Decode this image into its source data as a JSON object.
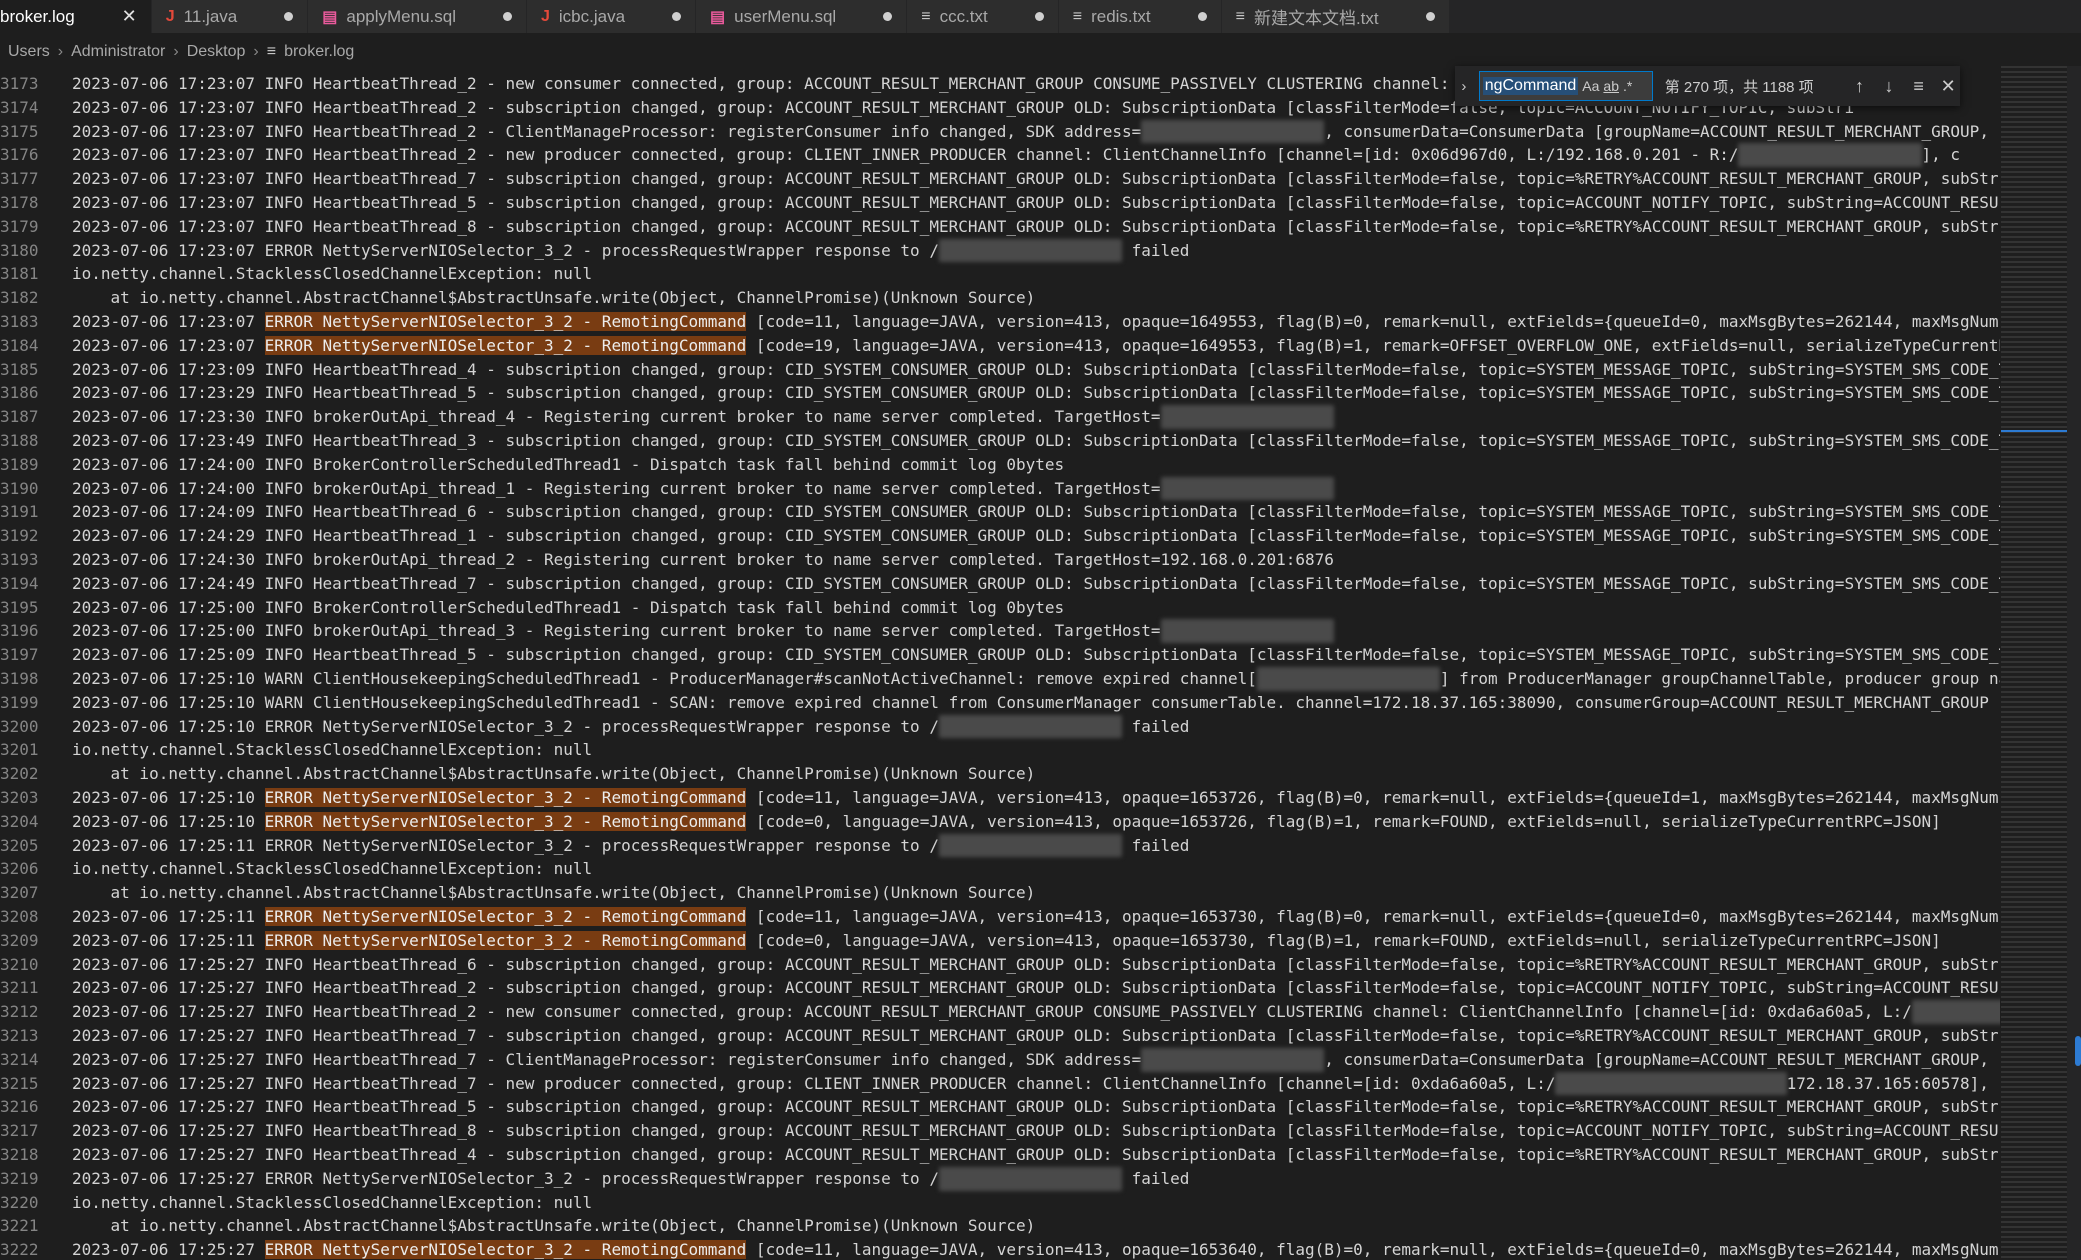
{
  "tabs": [
    {
      "label": "broker.log",
      "active": true,
      "icon": "log-file-icon"
    },
    {
      "label": "11.java",
      "icon": "java-icon"
    },
    {
      "label": "applyMenu.sql",
      "icon": "database-icon"
    },
    {
      "label": "icbc.java",
      "icon": "java-icon"
    },
    {
      "label": "userMenu.sql",
      "icon": "database-icon"
    },
    {
      "label": "ccc.txt",
      "icon": "text-file-icon"
    },
    {
      "label": "redis.txt",
      "icon": "text-file-icon"
    },
    {
      "label": "新建文本文档.txt",
      "icon": "text-file-icon"
    }
  ],
  "breadcrumb": [
    "Users",
    "Administrator",
    "Desktop",
    "broker.log"
  ],
  "find": {
    "term": "ngCommand",
    "opt_case": "Aa",
    "opt_word": "ab",
    "opt_regex": ".*",
    "count": "第 270 项，共 1188 项"
  },
  "colors": {
    "match_highlight": "#793c12",
    "find_border": "#007acc"
  },
  "lines": [
    {
      "n": "3173",
      "segs": [
        {
          "t": "2023-07-06 17:23:07 INFO HeartbeatThread_2 - new consumer connected, group: ACCOUNT_RESULT_MERCHANT_GROUP CONSUME_PASSIVELY CLUSTERING channel: ClientChannelInfo [channel=[id: 0x0"
        }
      ]
    },
    {
      "n": "3174",
      "segs": [
        {
          "t": "2023-07-06 17:23:07 INFO HeartbeatThread_2 - subscription changed, group: ACCOUNT_RESULT_MERCHANT_GROUP OLD: SubscriptionData [classFilterMode=false, topic=ACCOUNT_NOTIFY_TOPIC, subStri"
        }
      ]
    },
    {
      "n": "3175",
      "segs": [
        {
          "t": "2023-07-06 17:23:07 INFO HeartbeatThread_2 - ClientManageProcessor: registerConsumer info changed, SDK address="
        },
        {
          "t": "172.18.37.165:38090",
          "b": 1
        },
        {
          "t": ", consumerData=ConsumerData [groupName=ACCOUNT_RESULT_MERCHANT_GROUP, c"
        }
      ]
    },
    {
      "n": "3176",
      "segs": [
        {
          "t": "2023-07-06 17:23:07 INFO HeartbeatThread_2 - new producer connected, group: CLIENT_INNER_PRODUCER channel: ClientChannelInfo [channel=[id: 0x06d967d0, L:/192.168.0.201 - R:/"
        },
        {
          "t": "172.18.37.165:38090",
          "b": 1
        },
        {
          "t": "], c"
        }
      ]
    },
    {
      "n": "3177",
      "segs": [
        {
          "t": "2023-07-06 17:23:07 INFO HeartbeatThread_7 - subscription changed, group: ACCOUNT_RESULT_MERCHANT_GROUP OLD: SubscriptionData [classFilterMode=false, topic=%RETRY%ACCOUNT_RESULT_MERCHANT_GROUP, subStri"
        }
      ]
    },
    {
      "n": "3178",
      "segs": [
        {
          "t": "2023-07-06 17:23:07 INFO HeartbeatThread_5 - subscription changed, group: ACCOUNT_RESULT_MERCHANT_GROUP OLD: SubscriptionData [classFilterMode=false, topic=ACCOUNT_NOTIFY_TOPIC, subString=ACCOUNT_RESUL"
        }
      ]
    },
    {
      "n": "3179",
      "segs": [
        {
          "t": "2023-07-06 17:23:07 INFO HeartbeatThread_8 - subscription changed, group: ACCOUNT_RESULT_MERCHANT_GROUP OLD: SubscriptionData [classFilterMode=false, topic=%RETRY%ACCOUNT_RESULT_MERCHANT_GROUP, subStri"
        }
      ]
    },
    {
      "n": "3180",
      "segs": [
        {
          "t": "2023-07-06 17:23:07 ERROR NettyServerNIOSelector_3_2 - processRequestWrapper response to /"
        },
        {
          "t": "172.18.37.165:38090",
          "b": 1
        },
        {
          "t": " failed"
        }
      ]
    },
    {
      "n": "3181",
      "segs": [
        {
          "t": "io.netty.channel.StacklessClosedChannelException: null"
        }
      ]
    },
    {
      "n": "3182",
      "segs": [
        {
          "t": "    at io.netty.channel.AbstractChannel$AbstractUnsafe.write(Object, ChannelPromise)(Unknown Source)"
        }
      ]
    },
    {
      "n": "3183",
      "segs": [
        {
          "t": "2023-07-06 17:23:07 "
        },
        {
          "t": "ERROR NettyServerNIOSelector_3_2 - RemotingCommand",
          "h": 1
        },
        {
          "t": " [code=11, language=JAVA, version=413, opaque=1649553, flag(B)=0, remark=null, extFields={queueId=0, maxMsgBytes=262144, maxMsgNums"
        }
      ]
    },
    {
      "n": "3184",
      "segs": [
        {
          "t": "2023-07-06 17:23:07 "
        },
        {
          "t": "ERROR NettyServerNIOSelector_3_2 - RemotingCommand",
          "h": 1
        },
        {
          "t": " [code=19, language=JAVA, version=413, opaque=1649553, flag(B)=1, remark=OFFSET_OVERFLOW_ONE, extFields=null, serializeTypeCurrentR"
        }
      ]
    },
    {
      "n": "3185",
      "segs": [
        {
          "t": "2023-07-06 17:23:09 INFO HeartbeatThread_4 - subscription changed, group: CID_SYSTEM_CONSUMER_GROUP OLD: SubscriptionData [classFilterMode=false, topic=SYSTEM_MESSAGE_TOPIC, subString=SYSTEM_SMS_CODE_T"
        }
      ]
    },
    {
      "n": "3186",
      "segs": [
        {
          "t": "2023-07-06 17:23:29 INFO HeartbeatThread_5 - subscription changed, group: CID_SYSTEM_CONSUMER_GROUP OLD: SubscriptionData [classFilterMode=false, topic=SYSTEM_MESSAGE_TOPIC, subString=SYSTEM_SMS_CODE_T"
        }
      ]
    },
    {
      "n": "3187",
      "segs": [
        {
          "t": "2023-07-06 17:23:30 INFO brokerOutApi_thread_4 - Registering current broker to name server completed. TargetHost="
        },
        {
          "t": "192.168.0.201:6876",
          "b": 1
        }
      ]
    },
    {
      "n": "3188",
      "segs": [
        {
          "t": "2023-07-06 17:23:49 INFO HeartbeatThread_3 - subscription changed, group: CID_SYSTEM_CONSUMER_GROUP OLD: SubscriptionData [classFilterMode=false, topic=SYSTEM_MESSAGE_TOPIC, subString=SYSTEM_SMS_CODE_T"
        }
      ]
    },
    {
      "n": "3189",
      "segs": [
        {
          "t": "2023-07-06 17:24:00 INFO BrokerControllerScheduledThread1 - Dispatch task fall behind commit log 0bytes"
        }
      ]
    },
    {
      "n": "3190",
      "segs": [
        {
          "t": "2023-07-06 17:24:00 INFO brokerOutApi_thread_1 - Registering current broker to name server completed. TargetHost="
        },
        {
          "t": "192.168.0.201:6876",
          "b": 1
        }
      ]
    },
    {
      "n": "3191",
      "segs": [
        {
          "t": "2023-07-06 17:24:09 INFO HeartbeatThread_6 - subscription changed, group: CID_SYSTEM_CONSUMER_GROUP OLD: SubscriptionData [classFilterMode=false, topic=SYSTEM_MESSAGE_TOPIC, subString=SYSTEM_SMS_CODE_T"
        }
      ]
    },
    {
      "n": "3192",
      "segs": [
        {
          "t": "2023-07-06 17:24:29 INFO HeartbeatThread_1 - subscription changed, group: CID_SYSTEM_CONSUMER_GROUP OLD: SubscriptionData [classFilterMode=false, topic=SYSTEM_MESSAGE_TOPIC, subString=SYSTEM_SMS_CODE_T"
        }
      ]
    },
    {
      "n": "3193",
      "segs": [
        {
          "t": "2023-07-06 17:24:30 INFO brokerOutApi_thread_2 - Registering current broker to name server completed. TargetHost=192.168.0.201:6876"
        }
      ]
    },
    {
      "n": "3194",
      "segs": [
        {
          "t": "2023-07-06 17:24:49 INFO HeartbeatThread_7 - subscription changed, group: CID_SYSTEM_CONSUMER_GROUP OLD: SubscriptionData [classFilterMode=false, topic=SYSTEM_MESSAGE_TOPIC, subString=SYSTEM_SMS_CODE_T"
        }
      ]
    },
    {
      "n": "3195",
      "segs": [
        {
          "t": "2023-07-06 17:25:00 INFO BrokerControllerScheduledThread1 - Dispatch task fall behind commit log 0bytes"
        }
      ]
    },
    {
      "n": "3196",
      "segs": [
        {
          "t": "2023-07-06 17:25:00 INFO brokerOutApi_thread_3 - Registering current broker to name server completed. TargetHost="
        },
        {
          "t": "192.168.0.201:6876",
          "b": 1
        }
      ]
    },
    {
      "n": "3197",
      "segs": [
        {
          "t": "2023-07-06 17:25:09 INFO HeartbeatThread_5 - subscription changed, group: CID_SYSTEM_CONSUMER_GROUP OLD: SubscriptionData [classFilterMode=false, topic=SYSTEM_MESSAGE_TOPIC, subString=SYSTEM_SMS_CODE_T"
        }
      ]
    },
    {
      "n": "3198",
      "segs": [
        {
          "t": "2023-07-06 17:25:10 WARN ClientHousekeepingScheduledThread1 - ProducerManager#scanNotActiveChannel: remove expired channel["
        },
        {
          "t": "172.18.37.165:38090",
          "b": 1
        },
        {
          "t": "] from ProducerManager groupChannelTable, producer group na"
        }
      ]
    },
    {
      "n": "3199",
      "segs": [
        {
          "t": "2023-07-06 17:25:10 WARN ClientHousekeepingScheduledThread1 - SCAN: remove expired channel from ConsumerManager consumerTable. channel=172.18.37.165:38090, consumerGroup=ACCOUNT_RESULT_MERCHANT_GROUP"
        }
      ]
    },
    {
      "n": "3200",
      "segs": [
        {
          "t": "2023-07-06 17:25:10 ERROR NettyServerNIOSelector_3_2 - processRequestWrapper response to /"
        },
        {
          "t": "172.18.37.165:38090",
          "b": 1
        },
        {
          "t": " failed"
        }
      ]
    },
    {
      "n": "3201",
      "segs": [
        {
          "t": "io.netty.channel.StacklessClosedChannelException: null"
        }
      ]
    },
    {
      "n": "3202",
      "segs": [
        {
          "t": "    at io.netty.channel.AbstractChannel$AbstractUnsafe.write(Object, ChannelPromise)(Unknown Source)"
        }
      ]
    },
    {
      "n": "3203",
      "segs": [
        {
          "t": "2023-07-06 17:25:10 "
        },
        {
          "t": "ERROR NettyServerNIOSelector_3_2 - RemotingCommand",
          "h": 1
        },
        {
          "t": " [code=11, language=JAVA, version=413, opaque=1653726, flag(B)=0, remark=null, extFields={queueId=1, maxMsgBytes=262144, maxMsgNums"
        }
      ]
    },
    {
      "n": "3204",
      "segs": [
        {
          "t": "2023-07-06 17:25:10 "
        },
        {
          "t": "ERROR NettyServerNIOSelector_3_2 - RemotingCommand",
          "h": 1
        },
        {
          "t": " [code=0, language=JAVA, version=413, opaque=1653726, flag(B)=1, remark=FOUND, extFields=null, serializeTypeCurrentRPC=JSON]"
        }
      ]
    },
    {
      "n": "3205",
      "segs": [
        {
          "t": "2023-07-06 17:25:11 ERROR NettyServerNIOSelector_3_2 - processRequestWrapper response to /"
        },
        {
          "t": "172.18.37.165:38090",
          "b": 1
        },
        {
          "t": " failed"
        }
      ]
    },
    {
      "n": "3206",
      "segs": [
        {
          "t": "io.netty.channel.StacklessClosedChannelException: null"
        }
      ]
    },
    {
      "n": "3207",
      "segs": [
        {
          "t": "    at io.netty.channel.AbstractChannel$AbstractUnsafe.write(Object, ChannelPromise)(Unknown Source)"
        }
      ]
    },
    {
      "n": "3208",
      "segs": [
        {
          "t": "2023-07-06 17:25:11 "
        },
        {
          "t": "ERROR NettyServerNIOSelector_3_2 - RemotingCommand",
          "h": 1
        },
        {
          "t": " [code=11, language=JAVA, version=413, opaque=1653730, flag(B)=0, remark=null, extFields={queueId=0, maxMsgBytes=262144, maxMsgNums"
        }
      ]
    },
    {
      "n": "3209",
      "segs": [
        {
          "t": "2023-07-06 17:25:11 "
        },
        {
          "t": "ERROR NettyServerNIOSelector_3_2 - RemotingCommand",
          "h": 1
        },
        {
          "t": " [code=0, language=JAVA, version=413, opaque=1653730, flag(B)=1, remark=FOUND, extFields=null, serializeTypeCurrentRPC=JSON]"
        }
      ]
    },
    {
      "n": "3210",
      "segs": [
        {
          "t": "2023-07-06 17:25:27 INFO HeartbeatThread_6 - subscription changed, group: ACCOUNT_RESULT_MERCHANT_GROUP OLD: SubscriptionData [classFilterMode=false, topic=%RETRY%ACCOUNT_RESULT_MERCHANT_GROUP, subStri"
        }
      ]
    },
    {
      "n": "3211",
      "segs": [
        {
          "t": "2023-07-06 17:25:27 INFO HeartbeatThread_2 - subscription changed, group: ACCOUNT_RESULT_MERCHANT_GROUP OLD: SubscriptionData [classFilterMode=false, topic=ACCOUNT_NOTIFY_TOPIC, subString=ACCOUNT_RESUL"
        }
      ]
    },
    {
      "n": "3212",
      "segs": [
        {
          "t": "2023-07-06 17:25:27 INFO HeartbeatThread_2 - new consumer connected, group: ACCOUNT_RESULT_MERCHANT_GROUP CONSUME_PASSIVELY CLUSTERING channel: ClientChannelInfo [channel=[id: 0xda6a60a5, L:/"
        },
        {
          "t": "192.168.0.",
          "b": 1
        }
      ]
    },
    {
      "n": "3213",
      "segs": [
        {
          "t": "2023-07-06 17:25:27 INFO HeartbeatThread_7 - subscription changed, group: ACCOUNT_RESULT_MERCHANT_GROUP OLD: SubscriptionData [classFilterMode=false, topic=%RETRY%ACCOUNT_RESULT_MERCHANT_GROUP, subStri"
        }
      ]
    },
    {
      "n": "3214",
      "segs": [
        {
          "t": "2023-07-06 17:25:27 INFO HeartbeatThread_7 - ClientManageProcessor: registerConsumer info changed, SDK address="
        },
        {
          "t": "172.18.37.165:38090",
          "b": 1
        },
        {
          "t": ", consumerData=ConsumerData [groupName=ACCOUNT_RESULT_MERCHANT_GROUP, c"
        }
      ]
    },
    {
      "n": "3215",
      "segs": [
        {
          "t": "2023-07-06 17:25:27 INFO HeartbeatThread_7 - new producer connected, group: CLIENT_INNER_PRODUCER channel: ClientChannelInfo [channel=[id: 0xda6a60a5, L:/"
        },
        {
          "t": "192.168.0.201:6911 - R:/",
          "b": 1
        },
        {
          "t": "172.18.37.165:60578], c"
        }
      ]
    },
    {
      "n": "3216",
      "segs": [
        {
          "t": "2023-07-06 17:25:27 INFO HeartbeatThread_5 - subscription changed, group: ACCOUNT_RESULT_MERCHANT_GROUP OLD: SubscriptionData [classFilterMode=false, topic=%RETRY%ACCOUNT_RESULT_MERCHANT_GROUP, subStri"
        }
      ]
    },
    {
      "n": "3217",
      "segs": [
        {
          "t": "2023-07-06 17:25:27 INFO HeartbeatThread_8 - subscription changed, group: ACCOUNT_RESULT_MERCHANT_GROUP OLD: SubscriptionData [classFilterMode=false, topic=ACCOUNT_NOTIFY_TOPIC, subString=ACCOUNT_RESUL"
        }
      ]
    },
    {
      "n": "3218",
      "segs": [
        {
          "t": "2023-07-06 17:25:27 INFO HeartbeatThread_4 - subscription changed, group: ACCOUNT_RESULT_MERCHANT_GROUP OLD: SubscriptionData [classFilterMode=false, topic=%RETRY%ACCOUNT_RESULT_MERCHANT_GROUP, subStri"
        }
      ]
    },
    {
      "n": "3219",
      "segs": [
        {
          "t": "2023-07-06 17:25:27 ERROR NettyServerNIOSelector_3_2 - processRequestWrapper response to /"
        },
        {
          "t": "172.18.37.165:38090",
          "b": 1
        },
        {
          "t": " failed"
        }
      ]
    },
    {
      "n": "3220",
      "segs": [
        {
          "t": "io.netty.channel.StacklessClosedChannelException: null"
        }
      ]
    },
    {
      "n": "3221",
      "segs": [
        {
          "t": "    at io.netty.channel.AbstractChannel$AbstractUnsafe.write(Object, ChannelPromise)(Unknown Source)"
        }
      ]
    },
    {
      "n": "3222",
      "segs": [
        {
          "t": "2023-07-06 17:25:27 "
        },
        {
          "t": "ERROR NettyServerNIOSelector_3_2 - RemotingCommand",
          "h": 1
        },
        {
          "t": " [code=11, language=JAVA, version=413, opaque=1653640, flag(B)=0, remark=null, extFields={queueId=0, maxMsgBytes=262144, maxMsgNums"
        }
      ]
    }
  ]
}
